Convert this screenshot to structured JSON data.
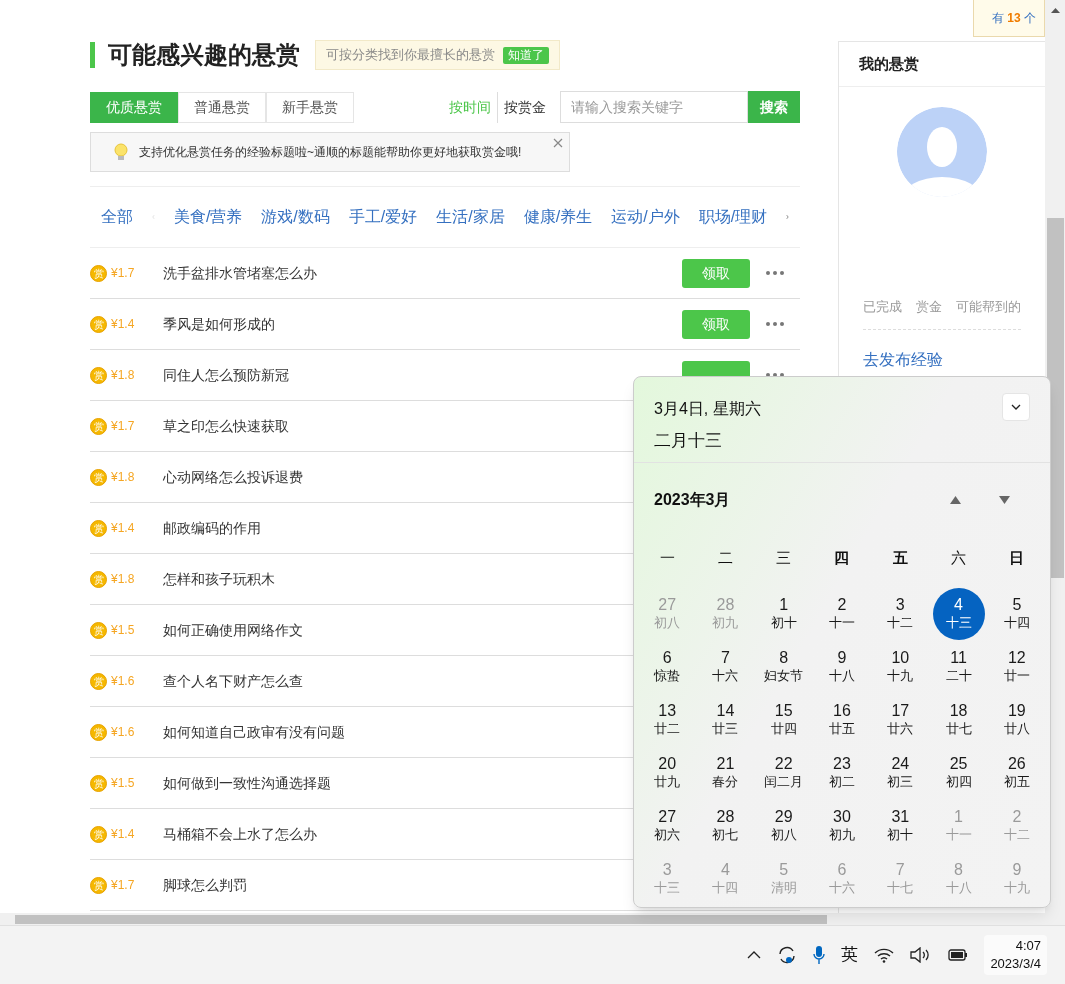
{
  "header": {
    "title": "可能感兴趣的悬赏",
    "tip": "可按分类找到你最擅长的悬赏",
    "tip_button": "知道了"
  },
  "tabs": [
    {
      "label": "优质悬赏",
      "selected": true
    },
    {
      "label": "普通悬赏",
      "selected": false
    },
    {
      "label": "新手悬赏",
      "selected": false
    }
  ],
  "sort": [
    {
      "label": "按时间",
      "selected": true
    },
    {
      "label": "按赏金",
      "selected": false
    }
  ],
  "search": {
    "placeholder": "请输入搜索关键字",
    "button": "搜索"
  },
  "notice": "支持优化悬赏任务的经验标题啦~通顺的标题能帮助你更好地获取赏金哦!",
  "categories": [
    {
      "label": "全部",
      "kind": "all"
    },
    {
      "label": "美食/营养",
      "kind": "cat"
    },
    {
      "label": "游戏/数码",
      "kind": "cat"
    },
    {
      "label": "手工/爱好",
      "kind": "cat"
    },
    {
      "label": "生活/家居",
      "kind": "cat"
    },
    {
      "label": "健康/养生",
      "kind": "cat"
    },
    {
      "label": "运动/户外",
      "kind": "cat"
    },
    {
      "label": "职场/理财",
      "kind": "cat"
    }
  ],
  "rows": [
    {
      "badge": "赏",
      "price": "¥1.7",
      "title": "洗手盆排水管堵塞怎么办",
      "button": "领取"
    },
    {
      "badge": "赏",
      "price": "¥1.4",
      "title": "季风是如何形成的",
      "button": "领取"
    },
    {
      "badge": "赏",
      "price": "¥1.8",
      "title": "同住人怎么预防新冠",
      "button_hidden": true
    },
    {
      "badge": "赏",
      "price": "¥1.7",
      "title": "草之印怎么快速获取"
    },
    {
      "badge": "赏",
      "price": "¥1.8",
      "title": "心动网络怎么投诉退费"
    },
    {
      "badge": "赏",
      "price": "¥1.4",
      "title": "邮政编码的作用"
    },
    {
      "badge": "赏",
      "price": "¥1.8",
      "title": "怎样和孩子玩积木"
    },
    {
      "badge": "赏",
      "price": "¥1.5",
      "title": "如何正确使用网络作文"
    },
    {
      "badge": "赏",
      "price": "¥1.6",
      "title": "查个人名下财产怎么查"
    },
    {
      "badge": "赏",
      "price": "¥1.6",
      "title": "如何知道自己政审有没有问题"
    },
    {
      "badge": "赏",
      "price": "¥1.5",
      "title": "如何做到一致性沟通选择题"
    },
    {
      "badge": "赏",
      "price": "¥1.4",
      "title": "马桶箱不会上水了怎么办"
    },
    {
      "badge": "赏",
      "price": "¥1.7",
      "title": "脚球怎么判罚"
    }
  ],
  "notification": {
    "prefix": "有",
    "count": "13",
    "suffix": "个"
  },
  "side": {
    "title": "我的悬赏",
    "stats": [
      "已完成",
      "赏金",
      "可能帮到的"
    ],
    "link": "去发布经验"
  },
  "calendar": {
    "date": "3月4日, 星期六",
    "lunar": "二月十三",
    "month": "2023年3月",
    "weekdays": [
      {
        "label": "一",
        "bold": false
      },
      {
        "label": "二",
        "bold": false
      },
      {
        "label": "三",
        "bold": false
      },
      {
        "label": "四",
        "bold": true
      },
      {
        "label": "五",
        "bold": true
      },
      {
        "label": "六",
        "bold": false
      },
      {
        "label": "日",
        "bold": true
      }
    ],
    "days": [
      {
        "day": "27",
        "lunar": "初八",
        "in_month": false,
        "selected": false
      },
      {
        "day": "28",
        "lunar": "初九",
        "in_month": false,
        "selected": false
      },
      {
        "day": "1",
        "lunar": "初十",
        "in_month": true,
        "selected": false
      },
      {
        "day": "2",
        "lunar": "十一",
        "in_month": true,
        "selected": false
      },
      {
        "day": "3",
        "lunar": "十二",
        "in_month": true,
        "selected": false
      },
      {
        "day": "4",
        "lunar": "十三",
        "in_month": true,
        "selected": true
      },
      {
        "day": "5",
        "lunar": "十四",
        "in_month": true,
        "selected": false
      },
      {
        "day": "6",
        "lunar": "惊蛰",
        "in_month": true,
        "selected": false
      },
      {
        "day": "7",
        "lunar": "十六",
        "in_month": true,
        "selected": false
      },
      {
        "day": "8",
        "lunar": "妇女节",
        "in_month": true,
        "selected": false
      },
      {
        "day": "9",
        "lunar": "十八",
        "in_month": true,
        "selected": false
      },
      {
        "day": "10",
        "lunar": "十九",
        "in_month": true,
        "selected": false
      },
      {
        "day": "11",
        "lunar": "二十",
        "in_month": true,
        "selected": false
      },
      {
        "day": "12",
        "lunar": "廿一",
        "in_month": true,
        "selected": false
      },
      {
        "day": "13",
        "lunar": "廿二",
        "in_month": true,
        "selected": false
      },
      {
        "day": "14",
        "lunar": "廿三",
        "in_month": true,
        "selected": false
      },
      {
        "day": "15",
        "lunar": "廿四",
        "in_month": true,
        "selected": false
      },
      {
        "day": "16",
        "lunar": "廿五",
        "in_month": true,
        "selected": false
      },
      {
        "day": "17",
        "lunar": "廿六",
        "in_month": true,
        "selected": false
      },
      {
        "day": "18",
        "lunar": "廿七",
        "in_month": true,
        "selected": false
      },
      {
        "day": "19",
        "lunar": "廿八",
        "in_month": true,
        "selected": false
      },
      {
        "day": "20",
        "lunar": "廿九",
        "in_month": true,
        "selected": false
      },
      {
        "day": "21",
        "lunar": "春分",
        "in_month": true,
        "selected": false
      },
      {
        "day": "22",
        "lunar": "闰二月",
        "in_month": true,
        "selected": false
      },
      {
        "day": "23",
        "lunar": "初二",
        "in_month": true,
        "selected": false
      },
      {
        "day": "24",
        "lunar": "初三",
        "in_month": true,
        "selected": false
      },
      {
        "day": "25",
        "lunar": "初四",
        "in_month": true,
        "selected": false
      },
      {
        "day": "26",
        "lunar": "初五",
        "in_month": true,
        "selected": false
      },
      {
        "day": "27",
        "lunar": "初六",
        "in_month": true,
        "selected": false
      },
      {
        "day": "28",
        "lunar": "初七",
        "in_month": true,
        "selected": false
      },
      {
        "day": "29",
        "lunar": "初八",
        "in_month": true,
        "selected": false
      },
      {
        "day": "30",
        "lunar": "初九",
        "in_month": true,
        "selected": false
      },
      {
        "day": "31",
        "lunar": "初十",
        "in_month": true,
        "selected": false
      },
      {
        "day": "1",
        "lunar": "十一",
        "in_month": false,
        "selected": false
      },
      {
        "day": "2",
        "lunar": "十二",
        "in_month": false,
        "selected": false
      },
      {
        "day": "3",
        "lunar": "十三",
        "in_month": false,
        "selected": false
      },
      {
        "day": "4",
        "lunar": "十四",
        "in_month": false,
        "selected": false
      },
      {
        "day": "5",
        "lunar": "清明",
        "in_month": false,
        "selected": false
      },
      {
        "day": "6",
        "lunar": "十六",
        "in_month": false,
        "selected": false
      },
      {
        "day": "7",
        "lunar": "十七",
        "in_month": false,
        "selected": false
      },
      {
        "day": "8",
        "lunar": "十八",
        "in_month": false,
        "selected": false
      },
      {
        "day": "9",
        "lunar": "十九",
        "in_month": false,
        "selected": false
      }
    ]
  },
  "taskbar": {
    "ime": "英",
    "time": "4:07",
    "date": "2023/3/4"
  }
}
